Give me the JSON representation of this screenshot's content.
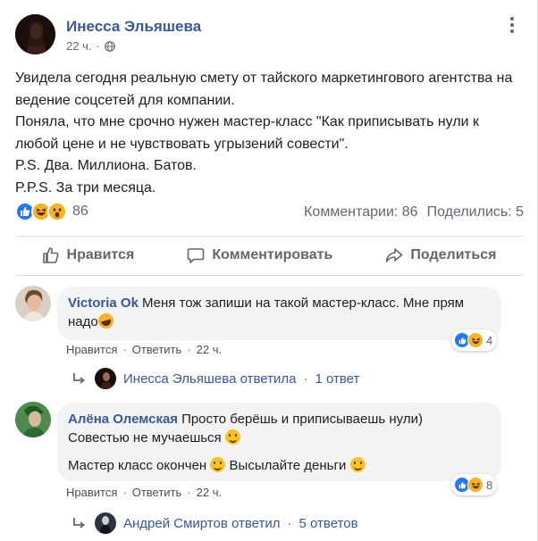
{
  "post": {
    "author": "Инесса Эльяшева",
    "time": "22 ч.",
    "paragraphs": [
      "Увидела сегодня реальную смету от тайского маркетингового агентства на ведение соцсетей для компании.",
      "Поняла, что мне срочно нужен мастер-класс \"Как приписывать нули к любой цене и не чувствовать угрызений совести\".",
      "P.S. Два. Миллиона. Батов.",
      "P.P.S. За три месяца."
    ],
    "reactions_count": "86",
    "comments_label": "Комментарии: 86",
    "shares_label": "Поделились: 5"
  },
  "actions": {
    "like": "Нравится",
    "comment": "Комментировать",
    "share": "Поделиться"
  },
  "comments": [
    {
      "author": "Victoria Ok",
      "text_line1": "Меня тож запиши на такой мастер-класс. Мне прям",
      "text_line2": "надо",
      "like": "Нравится",
      "reply": "Ответить",
      "time": "22 ч.",
      "reaction_count": "4",
      "reply_summary": {
        "author_replied": "Инесса Эльяшева ответила",
        "replies": "1 ответ"
      }
    },
    {
      "author": "Алёна Олемская",
      "text_line1": "Просто берёшь и приписываешь нули)",
      "text_line2": "Совестью не мучаешься",
      "text_line3": "Мастер класс окончен",
      "text_line3b": "Высылайте деньги",
      "like": "Нравится",
      "reply": "Ответить",
      "time": "22 ч.",
      "reaction_count": "8",
      "reply_summary": {
        "author_replied": "Андрей Смиртов ответил",
        "replies": "5 ответов"
      }
    }
  ],
  "colors": {
    "link": "#385898",
    "meta": "#606770",
    "bubble": "#f2f3f5",
    "like_blue": "#2078f4",
    "haha_yellow": "#f7b125"
  },
  "icons": [
    "globe-icon",
    "more-icon",
    "like-icon",
    "comment-icon",
    "share-icon",
    "reply-arrow-icon"
  ],
  "separator": "·"
}
